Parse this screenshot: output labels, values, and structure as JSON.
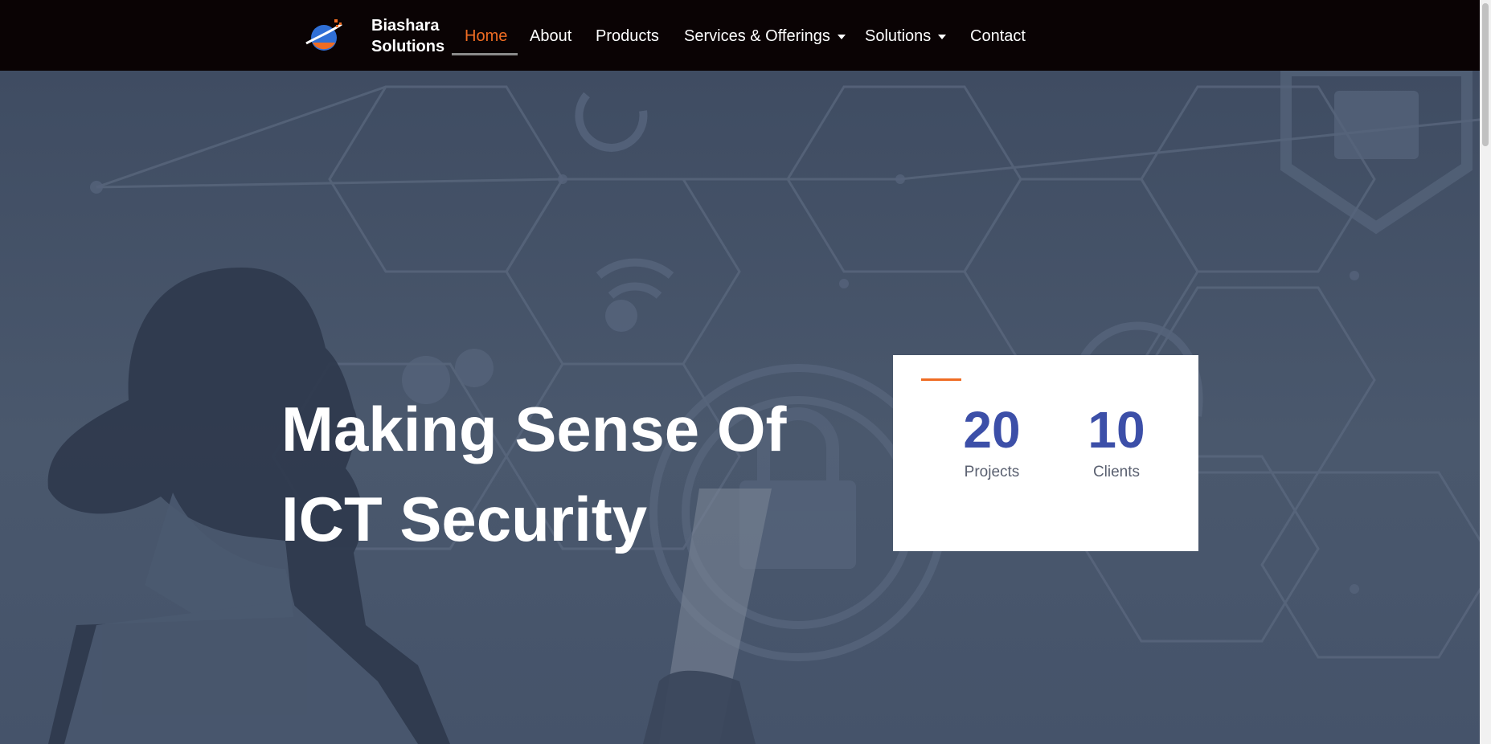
{
  "brand": {
    "line1": "Biashara",
    "line2": "Solutions"
  },
  "nav": {
    "home": "Home",
    "about": "About",
    "products": "Products",
    "services": "Services & Offerings",
    "solutions": "Solutions",
    "contact": "Contact"
  },
  "hero": {
    "title_line1": "Making Sense Of",
    "title_line2": "ICT Security"
  },
  "stats": [
    {
      "value": "20",
      "label": "Projects"
    },
    {
      "value": "10",
      "label": "Clients"
    }
  ],
  "colors": {
    "nav_bg": "#0a0304",
    "accent": "#ef6c23",
    "stat_value": "#3c4fa8",
    "hero_overlay": "#46546a"
  }
}
